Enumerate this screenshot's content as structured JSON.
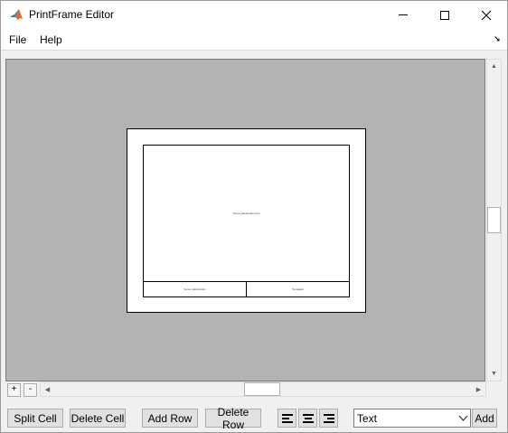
{
  "window": {
    "title": "PrintFrame Editor"
  },
  "menu": {
    "file": "File",
    "help": "Help"
  },
  "page": {
    "main_cell": "Some placeholder text",
    "bottom_left_cell": "Some placeholder",
    "bottom_right_cell": "Textagain"
  },
  "toolbar": {
    "split_cell": "Split Cell",
    "delete_cell": "Delete Cell",
    "add_row": "Add Row",
    "delete_row": "Delete Row",
    "type_selected": "Text",
    "add": "Add",
    "zoom_in": "+",
    "zoom_out": "-"
  },
  "colors": {
    "canvas_bg": "#b3b3b3",
    "window_bg": "#f0f0f0"
  }
}
